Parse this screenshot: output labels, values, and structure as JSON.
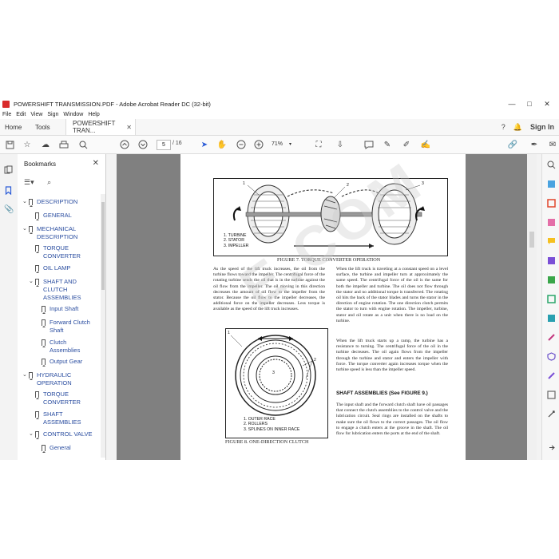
{
  "window": {
    "title": "POWERSHIFT TRANSMISSION.PDF - Adobe Acrobat Reader DC (32-bit)",
    "controls": [
      "—",
      "□",
      "✕"
    ]
  },
  "menu": [
    "File",
    "Edit",
    "View",
    "Sign",
    "Window",
    "Help"
  ],
  "tabs": {
    "home": "Home",
    "tools": "Tools",
    "document": "POWERSHIFT TRAN...",
    "signin": "Sign In"
  },
  "toolbar": {
    "page_current": "5",
    "page_total": "/ 16",
    "zoom": "71%"
  },
  "bookmarks": {
    "title": "Bookmarks",
    "items": [
      {
        "label": "DESCRIPTION",
        "level": 0,
        "expanded": true
      },
      {
        "label": "GENERAL",
        "level": 1
      },
      {
        "label": "MECHANICAL DESCRIPTION",
        "level": 0,
        "expanded": true
      },
      {
        "label": "TORQUE CONVERTER",
        "level": 1
      },
      {
        "label": "OIL LAMP",
        "level": 1
      },
      {
        "label": "SHAFT AND CLUTCH ASSEMBLIES",
        "level": 1,
        "expanded": true
      },
      {
        "label": "Input Shaft",
        "level": 2
      },
      {
        "label": "Forward Clutch Shaft",
        "level": 2
      },
      {
        "label": "Clutch Assemblies",
        "level": 2
      },
      {
        "label": "Output Gear",
        "level": 2
      },
      {
        "label": "HYDRAULIC OPERATION",
        "level": 0,
        "expanded": true
      },
      {
        "label": "TORQUE CONVERTER",
        "level": 1
      },
      {
        "label": "SHAFT ASSEMBLIES",
        "level": 1
      },
      {
        "label": "CONTROL VALVE",
        "level": 1,
        "expanded": true
      },
      {
        "label": "General",
        "level": 2
      }
    ]
  },
  "document": {
    "watermark": "E.COM",
    "figure7": {
      "caption": "FIGURE 7. TORQUE CONVERTER OPERATION",
      "legend": [
        "1. TURBINE",
        "2. STATOR",
        "3. IMPELLER"
      ],
      "callouts": [
        "1",
        "2",
        "3"
      ]
    },
    "figure8": {
      "caption": "FIGURE 8. ONE-DIRECTION CLUTCH",
      "legend": [
        "1. OUTER RACE",
        "2. ROLLERS",
        "3. SPLINES ON INNER RACE"
      ],
      "callouts": [
        "1",
        "2",
        "3"
      ]
    },
    "left_paragraph": "As the speed of the lift truck increases, the oil from the turbine flows toward the impeller. The centrifugal force of the rotating turbine sends the oil that is in the turbine against the oil flow from the impeller. The oil moving in this direction decreases the amount of oil flow to the impeller from the stator. Because the oil flow to the impeller decreases, the additional force on the impeller decreases. Less torque is available as the speed of the lift truck increases.",
    "right_paragraph_1": "When the lift truck is traveling at a constant speed on a level surface, the turbine and impeller turn at approximately the same speed. The centrifugal force of the oil is the same for both the impeller and turbine. The oil does not flow through the stator and no additional torque is transferred. The rotating oil hits the back of the stator blades and turns the stator in the direction of engine rotation. The one direction clutch permits the stator to turn with engine rotation. The impeller, turbine, stator and oil rotate as a unit when there is no load on the turbine.",
    "right_paragraph_2": "When the lift truck starts up a ramp, the turbine has a resistance to turning. The centrifugal force of the oil in the turbine decreases. The oil again flows from the impeller through the turbine and stator and enters the impeller with force. The torque converter again increases torque when the turbine speed is less than the impeller speed.",
    "heading": "SHAFT ASSEMBLIES (See FIGURE 9.)",
    "right_paragraph_3": "The input shaft and the forward clutch shaft have oil passages that connect the clutch assemblies to the control valve and the lubrication circuit. Seal rings are installed on the shafts to make sure the oil flows to the correct passages. The oil flow to engage a clutch enters at the groove in the shaft. The oil flow for lubrication enters the ports at the end of the shaft."
  }
}
